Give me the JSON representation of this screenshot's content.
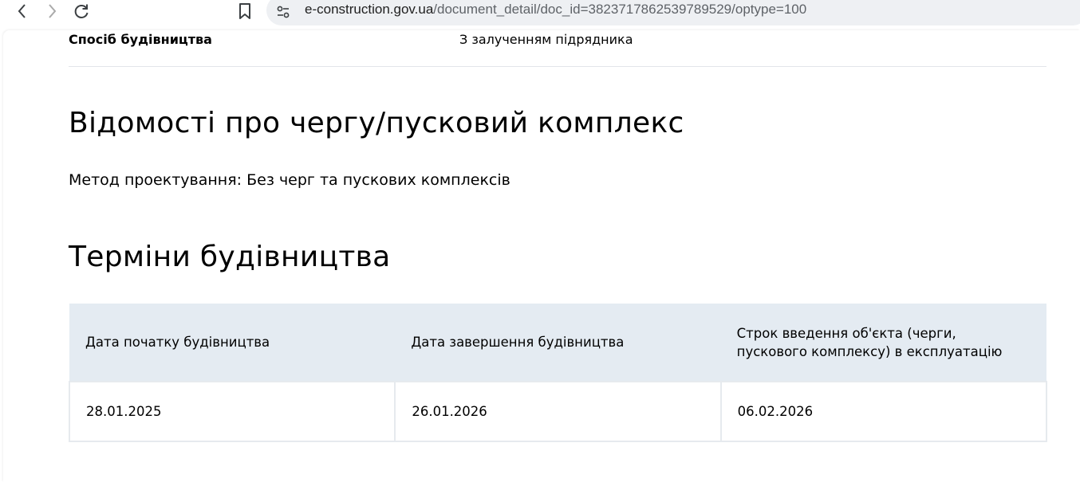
{
  "browser": {
    "url_host": "e-construction.gov.ua",
    "url_path": "/document_detail/doc_id=3823717862539789529/optype=100"
  },
  "construction_method": {
    "label": "Спосіб будівництва",
    "value": "З залученням підрядника"
  },
  "queue_section": {
    "title": "Відомості про чергу/пусковий комплекс",
    "design_method": "Метод проектування: Без черг та пускових комплексів"
  },
  "terms_section": {
    "title": "Терміни будівництва",
    "headers": [
      "Дата початку будівництва",
      "Дата завершення будівництва",
      "Строк введення об'єкта (черги, пускового комплексу) в експлуатацію"
    ],
    "row": [
      "28.01.2025",
      "26.01.2026",
      "06.02.2026"
    ]
  }
}
